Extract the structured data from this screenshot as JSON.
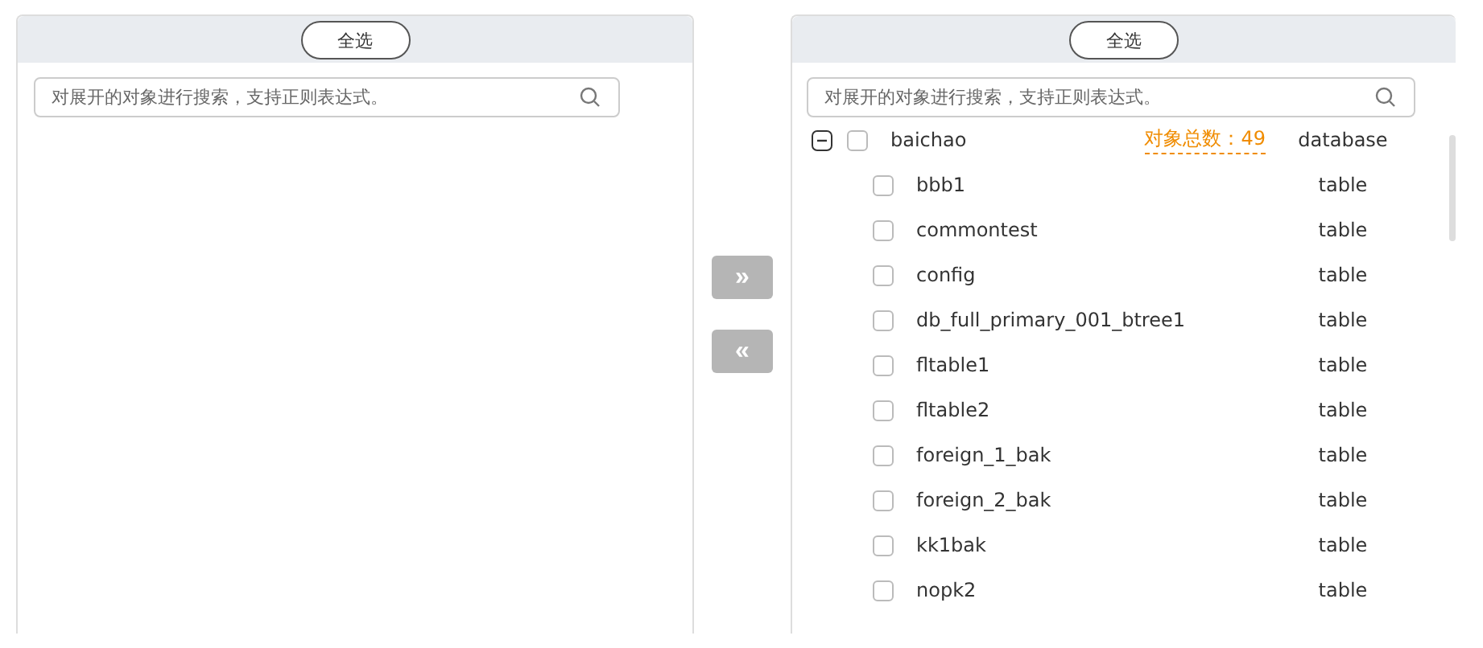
{
  "left_panel": {
    "select_all": "全选",
    "search": {
      "placeholder": "对展开的对象进行搜索，支持正则表达式。"
    }
  },
  "move_buttons": [
    {
      "label": "»",
      "disabled": true
    },
    {
      "label": "«",
      "disabled": true
    }
  ],
  "right_panel": {
    "select_all": "全选",
    "search": {
      "placeholder": "对展开的对象进行搜索，支持正则表达式。"
    },
    "tree": [
      {
        "name": "baichao",
        "count": "对象总数：49",
        "type": "database",
        "expanded": true,
        "checked": false,
        "children": [
          {
            "name": "bbb1",
            "type": "table",
            "checked": false
          },
          {
            "name": "commontest",
            "type": "table",
            "checked": false
          },
          {
            "name": "config",
            "type": "table",
            "checked": false
          },
          {
            "name": "db_full_primary_001_btree1",
            "type": "table",
            "checked": false
          },
          {
            "name": "fltable1",
            "type": "table",
            "checked": false
          },
          {
            "name": "fltable2",
            "type": "table",
            "checked": false
          },
          {
            "name": "foreign_1_bak",
            "type": "table",
            "checked": false
          },
          {
            "name": "foreign_2_bak",
            "type": "table",
            "checked": false
          },
          {
            "name": "kk1bak",
            "type": "table",
            "checked": false
          },
          {
            "name": "nopk2",
            "type": "table",
            "checked": false
          }
        ]
      }
    ]
  }
}
